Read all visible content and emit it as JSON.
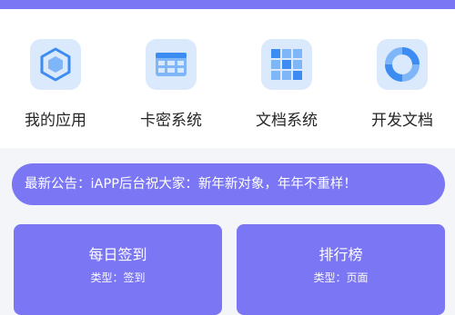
{
  "theme": {
    "accent": "#7b76f4",
    "icon_bg": "#dbe9fd",
    "icon_blue": "#3d8cf2",
    "icon_light_blue": "#7fb6f8",
    "page_bg": "#f4f5f9"
  },
  "menu": {
    "items": [
      {
        "label": "我的应用",
        "icon": "hexagon-app-icon"
      },
      {
        "label": "卡密系统",
        "icon": "card-table-icon"
      },
      {
        "label": "文档系统",
        "icon": "grid-document-icon"
      },
      {
        "label": "开发文档",
        "icon": "pie-chart-icon"
      }
    ]
  },
  "notice": {
    "text": "最新公告：iAPP后台祝大家：新年新对象，年年不重样！"
  },
  "cards": [
    {
      "title": "每日签到",
      "subtitle": "类型：签到"
    },
    {
      "title": "排行榜",
      "subtitle": "类型：页面"
    }
  ]
}
